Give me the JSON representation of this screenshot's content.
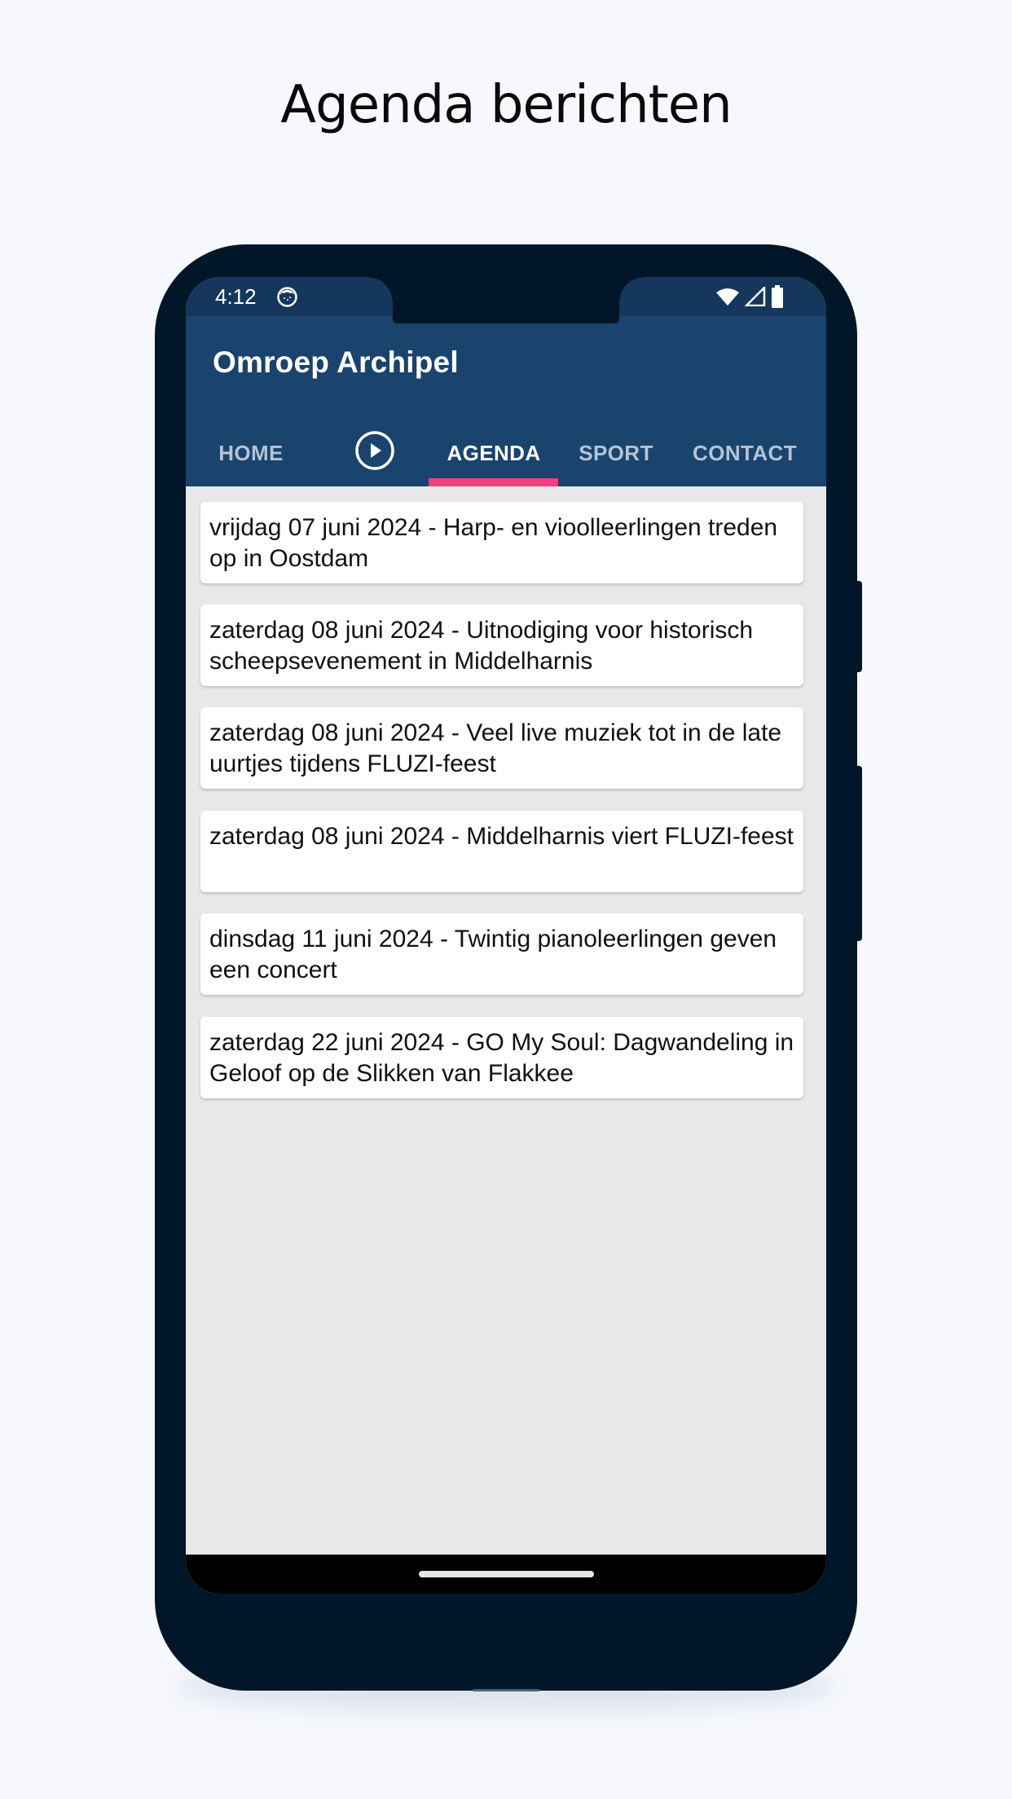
{
  "promo": {
    "title": "Agenda berichten"
  },
  "status_bar": {
    "time": "4:12",
    "left_icons": [
      "app-notification-icon"
    ],
    "right_icons": [
      "wifi-icon",
      "cellular-signal-icon",
      "battery-icon"
    ]
  },
  "app_bar": {
    "title": "Omroep Archipel"
  },
  "tabs": [
    {
      "label": "HOME",
      "active": false
    },
    {
      "label": "",
      "icon": "play-circle-icon",
      "active": false
    },
    {
      "label": "AGENDA",
      "active": true
    },
    {
      "label": "SPORT",
      "active": false
    },
    {
      "label": "CONTACT",
      "active": false
    }
  ],
  "agenda": {
    "items": [
      {
        "text": "vrijdag 07 juni 2024 - Harp- en vioolleerlingen treden op in Oostdam"
      },
      {
        "text": "zaterdag 08 juni 2024 - Uitnodiging voor historisch scheepsevenement in Middelharnis"
      },
      {
        "text": "zaterdag 08 juni 2024 - Veel live muziek tot in de late uurtjes tijdens FLUZI-feest"
      },
      {
        "text": "zaterdag 08 juni 2024 - Middelharnis viert FLUZI-feest"
      },
      {
        "text": "dinsdag 11 juni 2024 - Twintig pianoleerlingen geven een concert"
      },
      {
        "text": "zaterdag 22 juni 2024 - GO My Soul: Dagwandeling in Geloof op de Slikken van Flakkee"
      }
    ]
  },
  "colors": {
    "app_bar": "#1a436d",
    "status_bar": "#15375c",
    "tab_indicator": "#f13f7e",
    "content_background": "#e8e8e8",
    "phone_frame": "#021629",
    "page_background": "#f6f8fd"
  }
}
